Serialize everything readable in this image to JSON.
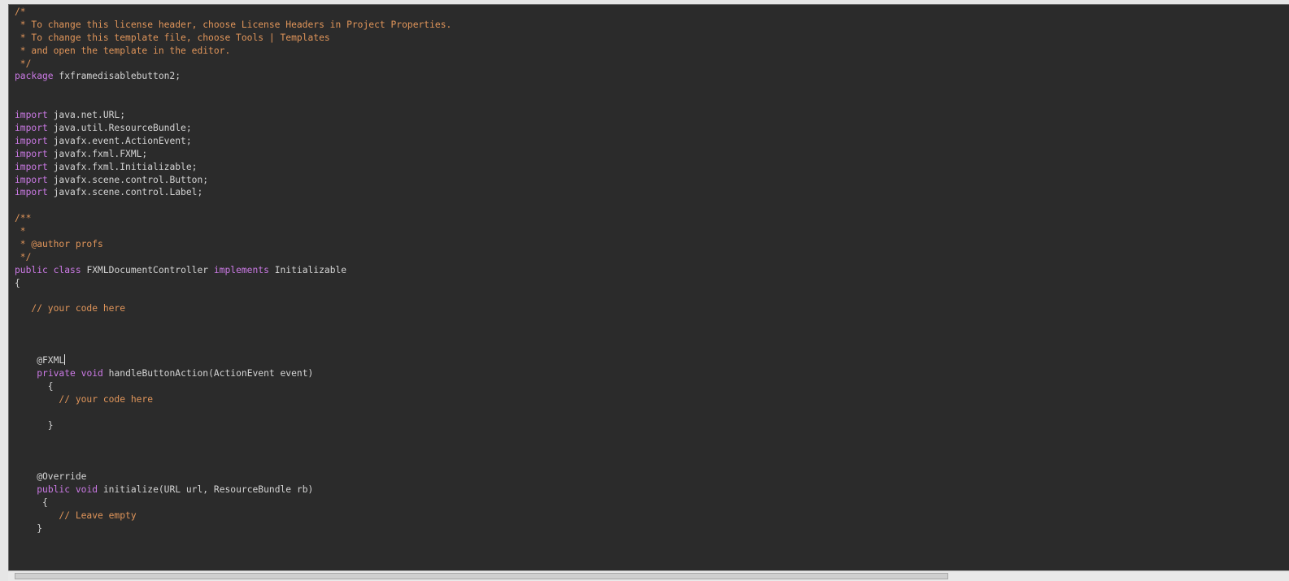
{
  "editor": {
    "caret_after_line": 27,
    "lines": [
      [
        {
          "t": "c",
          "v": "/*"
        }
      ],
      [
        {
          "t": "c",
          "v": " * To change this license header, choose License Headers in Project Properties."
        }
      ],
      [
        {
          "t": "c",
          "v": " * To change this template file, choose Tools | Templates"
        }
      ],
      [
        {
          "t": "c",
          "v": " * and open the template in the editor."
        }
      ],
      [
        {
          "t": "c",
          "v": " */"
        }
      ],
      [
        {
          "t": "k",
          "v": "package"
        },
        {
          "t": "x",
          "v": " fxframedisablebutton2;"
        }
      ],
      [],
      [],
      [
        {
          "t": "k",
          "v": "import"
        },
        {
          "t": "x",
          "v": " java.net.URL;"
        }
      ],
      [
        {
          "t": "k",
          "v": "import"
        },
        {
          "t": "x",
          "v": " java.util.ResourceBundle;"
        }
      ],
      [
        {
          "t": "k",
          "v": "import"
        },
        {
          "t": "x",
          "v": " javafx.event.ActionEvent;"
        }
      ],
      [
        {
          "t": "k",
          "v": "import"
        },
        {
          "t": "x",
          "v": " javafx.fxml.FXML;"
        }
      ],
      [
        {
          "t": "k",
          "v": "import"
        },
        {
          "t": "x",
          "v": " javafx.fxml.Initializable;"
        }
      ],
      [
        {
          "t": "k",
          "v": "import"
        },
        {
          "t": "x",
          "v": " javafx.scene.control.Button;"
        }
      ],
      [
        {
          "t": "k",
          "v": "import"
        },
        {
          "t": "x",
          "v": " javafx.scene.control.Label;"
        }
      ],
      [],
      [
        {
          "t": "c",
          "v": "/**"
        }
      ],
      [
        {
          "t": "c",
          "v": " *"
        }
      ],
      [
        {
          "t": "c",
          "v": " * @author profs"
        }
      ],
      [
        {
          "t": "c",
          "v": " */"
        }
      ],
      [
        {
          "t": "k",
          "v": "public"
        },
        {
          "t": "x",
          "v": " "
        },
        {
          "t": "k",
          "v": "class"
        },
        {
          "t": "x",
          "v": " FXMLDocumentController "
        },
        {
          "t": "k",
          "v": "implements"
        },
        {
          "t": "x",
          "v": " Initializable"
        }
      ],
      [
        {
          "t": "x",
          "v": "{"
        }
      ],
      [],
      [
        {
          "t": "c",
          "v": "   // your code here"
        }
      ],
      [],
      [],
      [],
      [
        {
          "t": "a",
          "v": "    @FXML"
        }
      ],
      [
        {
          "t": "x",
          "v": "    "
        },
        {
          "t": "k",
          "v": "private"
        },
        {
          "t": "x",
          "v": " "
        },
        {
          "t": "k",
          "v": "void"
        },
        {
          "t": "x",
          "v": " handleButtonAction(ActionEvent event)"
        }
      ],
      [
        {
          "t": "x",
          "v": "      {"
        }
      ],
      [
        {
          "t": "c",
          "v": "        // your code here"
        }
      ],
      [],
      [
        {
          "t": "x",
          "v": "      }"
        }
      ],
      [],
      [],
      [],
      [
        {
          "t": "a",
          "v": "    @Override"
        }
      ],
      [
        {
          "t": "x",
          "v": "    "
        },
        {
          "t": "k",
          "v": "public"
        },
        {
          "t": "x",
          "v": " "
        },
        {
          "t": "k",
          "v": "void"
        },
        {
          "t": "x",
          "v": " initialize(URL url, ResourceBundle rb)"
        }
      ],
      [
        {
          "t": "x",
          "v": "     {"
        }
      ],
      [
        {
          "t": "c",
          "v": "        // Leave empty"
        }
      ],
      [
        {
          "t": "x",
          "v": "    }"
        }
      ]
    ]
  },
  "colors": {
    "background": "#2b2b2b",
    "keyword": "#cc7ae6",
    "comment": "#e0955a",
    "text": "#d4d4d4"
  }
}
